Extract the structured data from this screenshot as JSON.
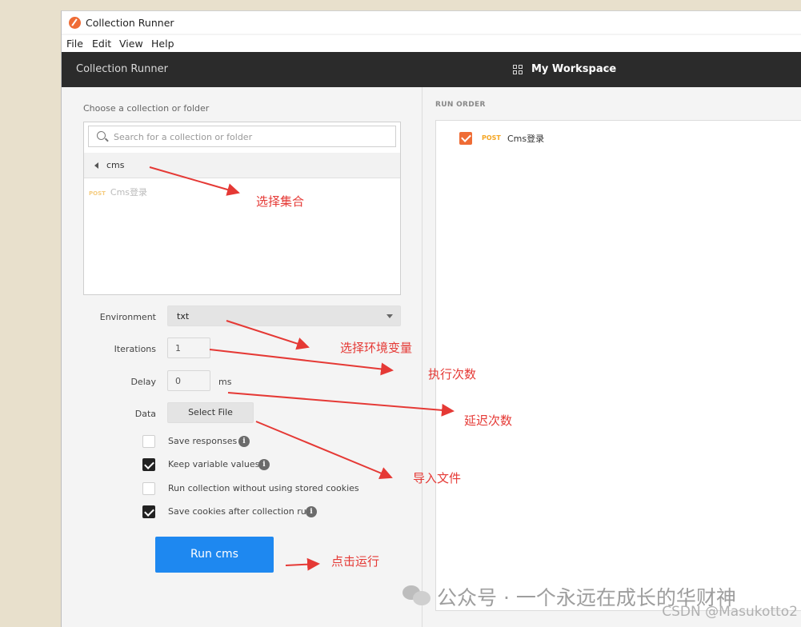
{
  "window": {
    "title": "Collection Runner"
  },
  "menu": [
    "File",
    "Edit",
    "View",
    "Help"
  ],
  "topbar": {
    "title": "Collection Runner",
    "workspace": "My Workspace"
  },
  "left": {
    "section_label": "Choose a collection or folder",
    "search_placeholder": "Search for a collection or folder",
    "folder": "cms",
    "request": {
      "method": "POST",
      "name": "Cms登录"
    },
    "environment": {
      "label": "Environment",
      "value": "txt"
    },
    "iterations": {
      "label": "Iterations",
      "value": "1"
    },
    "delay": {
      "label": "Delay",
      "value": "0",
      "unit": "ms"
    },
    "data": {
      "label": "Data",
      "button": "Select File"
    },
    "options": [
      {
        "label": "Save responses",
        "checked": false,
        "info": true
      },
      {
        "label": "Keep variable values",
        "checked": true,
        "info": true
      },
      {
        "label": "Run collection without using stored cookies",
        "checked": false,
        "info": false
      },
      {
        "label": "Save cookies after collection run",
        "checked": true,
        "info": true
      }
    ],
    "run_button": "Run cms"
  },
  "right": {
    "run_order_label": "RUN ORDER",
    "items": [
      {
        "method": "POST",
        "name": "Cms登录",
        "checked": true
      }
    ]
  },
  "annotations": {
    "select_collection": "选择集合",
    "select_env": "选择环境变量",
    "iterations": "执行次数",
    "delay": "延迟次数",
    "import_file": "导入文件",
    "click_run": "点击运行"
  },
  "watermark": {
    "text": "公众号 · 一个永远在成长的华财神",
    "csdn": "CSDN @Masukotto2"
  },
  "colors": {
    "accent": "#1e88f0",
    "brand": "#ef6c35",
    "post": "#f5a623",
    "annotation": "#e53935",
    "topbar": "#2b2b2b"
  }
}
